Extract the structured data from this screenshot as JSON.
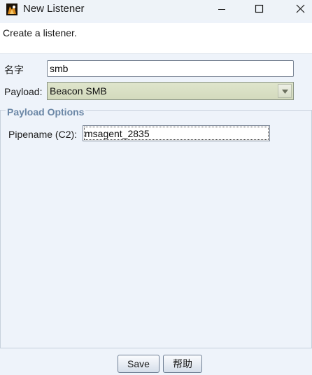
{
  "window": {
    "title": "New Listener",
    "icon": "cobalt-strike-app-icon"
  },
  "header": {
    "description": "Create a listener."
  },
  "form": {
    "name_label": "名字",
    "name_value": "smb",
    "payload_label": "Payload:",
    "payload_value": "Beacon SMB"
  },
  "payload_options": {
    "title": "Payload Options",
    "pipename_label": "Pipename (C2):",
    "pipename_value": "msagent_2835"
  },
  "buttons": {
    "save": "Save",
    "help": "帮助"
  },
  "colors": {
    "background": "#eef3fa",
    "group_title": "#6b87a6",
    "select_fill": "#d9dfc5"
  }
}
